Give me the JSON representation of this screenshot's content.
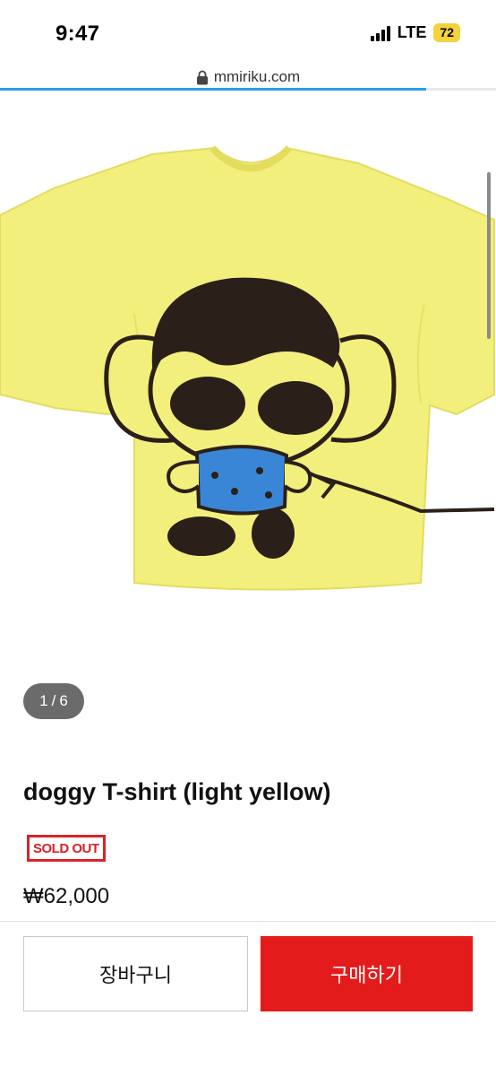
{
  "status": {
    "time": "9:47",
    "network": "LTE",
    "battery": "72"
  },
  "browser": {
    "url": "mmiriku.com",
    "load_progress_fraction": 0.86
  },
  "product": {
    "image_alt_icon": "yellow-tshirt-image",
    "image_counter": {
      "current": "1",
      "separator": "/",
      "total": "6"
    },
    "title": "doggy T-shirt (light yellow)",
    "sold_out_label": "SOLD OUT",
    "price": "₩62,000"
  },
  "actions": {
    "cart_label": "장바구니",
    "buy_label": "구매하기"
  },
  "colors": {
    "accent_red": "#e41b1b",
    "shirt_yellow": "#f3ef7c",
    "progress_blue": "#2a9de9",
    "battery_yellow": "#f4d23c"
  }
}
